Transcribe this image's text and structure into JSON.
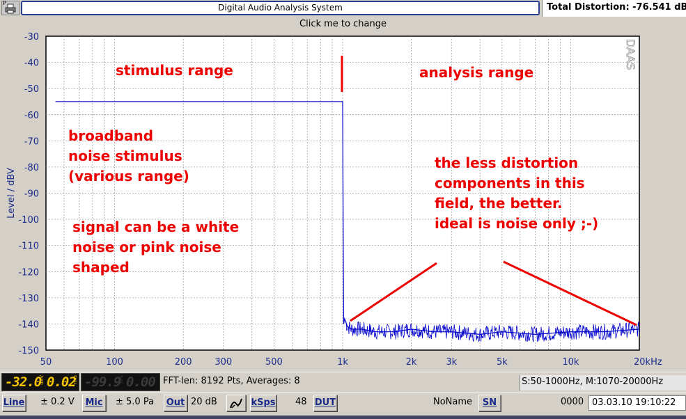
{
  "titlebar": {
    "print_letter": "P",
    "app_title": "Digital Audio Analysis System",
    "total_distortion": "Total Distortion: -76.541 dB"
  },
  "plot": {
    "header": "Click me to change",
    "watermark": "DAAS",
    "annotations": [
      {
        "id": "stimulus-range",
        "lines": [
          "stimulus range"
        ]
      },
      {
        "id": "analysis-range",
        "lines": [
          "analysis range"
        ]
      },
      {
        "id": "broadband",
        "lines": [
          "broadband",
          "noise stimulus",
          "(various range)"
        ]
      },
      {
        "id": "signal-note",
        "lines": [
          "signal can be a white",
          "noise or pink noise",
          "shaped"
        ]
      },
      {
        "id": "distortion-note",
        "lines": [
          "the less distortion",
          "components in this",
          "field, the better.",
          "ideal is noise only ;-)"
        ]
      }
    ],
    "colors": {
      "trace": "#0000cc",
      "annotation": "#ee0000",
      "axis_text": "#1a2a8a",
      "grid": "#909090"
    }
  },
  "chart_data": {
    "type": "line",
    "title": "",
    "xlabel": "",
    "ylabel": "Level / dBV",
    "x_scale": "log",
    "xlim": [
      50,
      20000
    ],
    "ylim": [
      -150,
      -30
    ],
    "x_tick_labels": [
      "50",
      "100",
      "200",
      "300",
      "500",
      "1k",
      "2k",
      "3k",
      "5k",
      "10k",
      "20kHz"
    ],
    "x_tick_values": [
      50,
      100,
      200,
      300,
      500,
      1000,
      2000,
      3000,
      5000,
      10000,
      20000
    ],
    "y_tick_values": [
      -30,
      -40,
      -50,
      -60,
      -70,
      -80,
      -90,
      -100,
      -110,
      -120,
      -130,
      -140,
      -150
    ],
    "grid": true,
    "series": [
      {
        "x": [
          55,
          1000,
          1005,
          1010,
          1020,
          1050,
          1100,
          1200,
          1400,
          1700,
          2000,
          2500,
          3000,
          4000,
          5000,
          7000,
          10000,
          14000,
          20000
        ],
        "y": [
          -55,
          -55,
          -100,
          -140,
          -138,
          -141,
          -142,
          -142,
          -143,
          -143,
          -142,
          -143,
          -143,
          -144,
          -143,
          -144,
          -143,
          -143,
          -142
        ]
      }
    ]
  },
  "info": {
    "lcd1_value": "-32.0",
    "lcd1_unit": "dBV",
    "lcd1_value2": "0.02",
    "lcd1_unit2": "rms",
    "lcd2_value": "-99.9",
    "lcd2_unit": "SPL",
    "lcd2_value2": "0.00",
    "fft": "FFT-len: 8192 Pts, Averages: 8",
    "range": "S:50-1000Hz, M:1070-20000Hz"
  },
  "controls": {
    "line_label": "Line",
    "line_value": "± 0.2 V",
    "mic_label": "Mic",
    "mic_value": "± 5.0 Pa",
    "out_label": "Out",
    "out_value": "20 dB",
    "ksps_label": "kSps",
    "ksps_value": "48",
    "dut_label": "DUT",
    "name_value": "NoName",
    "sn_label": "SN",
    "counter": "0000",
    "datetime": "03.03.10 19:10:22"
  }
}
